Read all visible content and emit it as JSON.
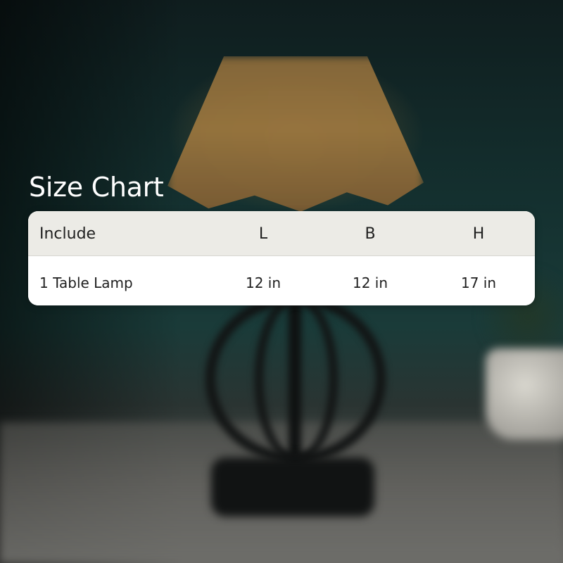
{
  "title": "Size Chart",
  "table": {
    "headers": {
      "include": "Include",
      "length": "L",
      "breadth": "B",
      "height": "H"
    },
    "rows": [
      {
        "include": "1 Table Lamp",
        "length": "12 in",
        "breadth": "12 in",
        "height": "17 in"
      }
    ]
  },
  "colors": {
    "title_text": "#ffffff",
    "table_header_bg": "#ecebe6",
    "table_body_bg": "#ffffff",
    "table_text": "#1f1f1f"
  }
}
